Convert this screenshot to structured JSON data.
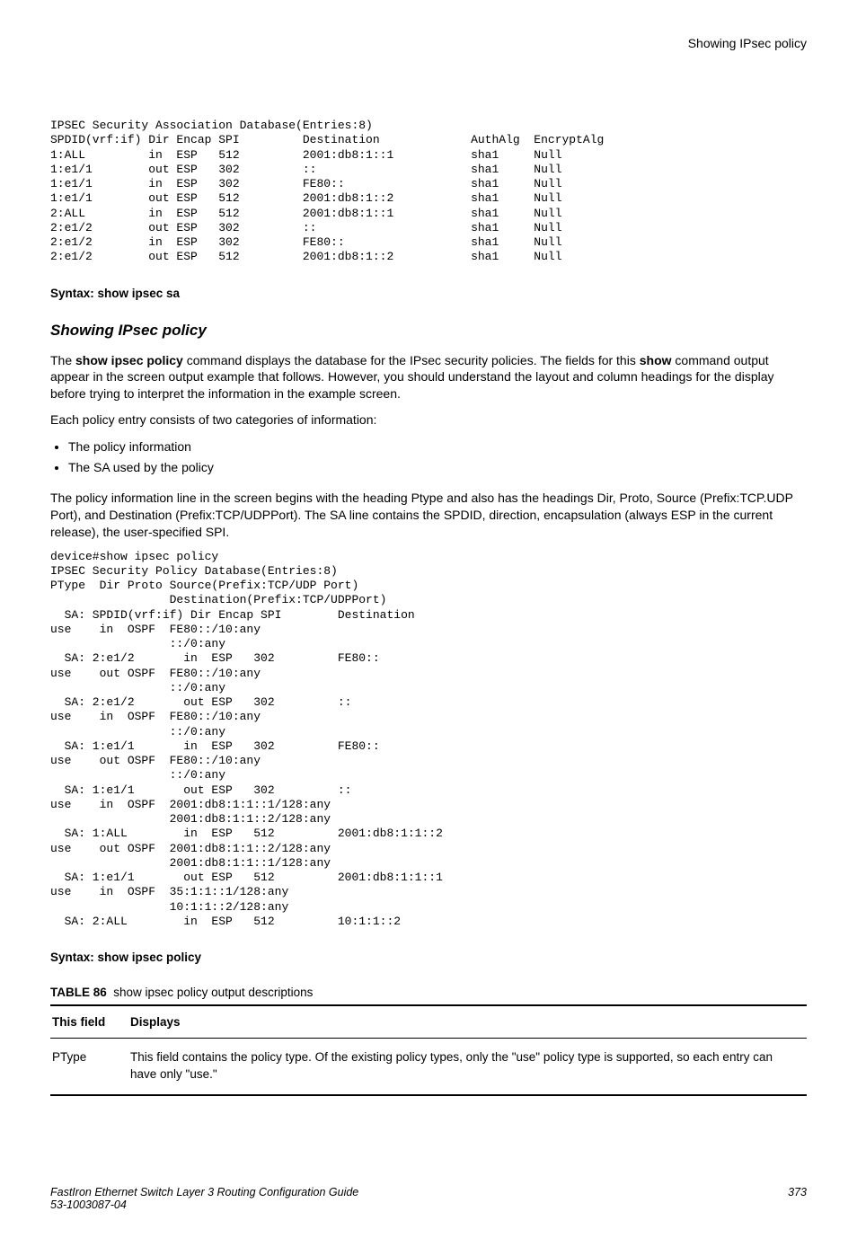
{
  "header": {
    "right_title": "Showing IPsec policy"
  },
  "code1": "IPSEC Security Association Database(Entries:8)\nSPDID(vrf:if) Dir Encap SPI         Destination             AuthAlg  EncryptAlg\n1:ALL         in  ESP   512         2001:db8:1::1           sha1     Null\n1:e1/1        out ESP   302         ::                      sha1     Null\n1:e1/1        in  ESP   302         FE80::                  sha1     Null\n1:e1/1        out ESP   512         2001:db8:1::2           sha1     Null\n2:ALL         in  ESP   512         2001:db8:1::1           sha1     Null\n2:e1/2        out ESP   302         ::                      sha1     Null\n2:e1/2        in  ESP   302         FE80::                  sha1     Null\n2:e1/2        out ESP   512         2001:db8:1::2           sha1     Null",
  "syntax1": "Syntax: show ipsec sa",
  "section_title": "Showing IPsec policy",
  "para1_pre": "The ",
  "para1_cmd1": "show ipsec policy",
  "para1_mid": " command displays the database for the IPsec security policies. The fields for this ",
  "para1_cmd2": "show",
  "para1_post": " command output appear in the screen output example that follows. However, you should understand the layout and column headings for the display before trying to interpret the information in the example screen.",
  "para2": "Each policy entry consists of two categories of information:",
  "bullets": [
    "The policy information",
    "The SA used by the policy"
  ],
  "para3": "The policy information line in the screen begins with the heading Ptype and also has the headings Dir, Proto, Source (Prefix:TCP.UDP Port), and Destination (Prefix:TCP/UDPPort). The SA line contains the SPDID, direction, encapsulation (always ESP in the current release), the user-specified SPI.",
  "code2": "device#show ipsec policy\nIPSEC Security Policy Database(Entries:8)\nPType  Dir Proto Source(Prefix:TCP/UDP Port)\n                 Destination(Prefix:TCP/UDPPort)\n  SA: SPDID(vrf:if) Dir Encap SPI        Destination\nuse    in  OSPF  FE80::/10:any\n                 ::/0:any\n  SA: 2:e1/2       in  ESP   302         FE80::\nuse    out OSPF  FE80::/10:any\n                 ::/0:any\n  SA: 2:e1/2       out ESP   302         ::\nuse    in  OSPF  FE80::/10:any\n                 ::/0:any\n  SA: 1:e1/1       in  ESP   302         FE80::\nuse    out OSPF  FE80::/10:any\n                 ::/0:any\n  SA: 1:e1/1       out ESP   302         ::\nuse    in  OSPF  2001:db8:1:1::1/128:any\n                 2001:db8:1:1::2/128:any\n  SA: 1:ALL        in  ESP   512         2001:db8:1:1::2\nuse    out OSPF  2001:db8:1:1::2/128:any\n                 2001:db8:1:1::1/128:any\n  SA: 1:e1/1       out ESP   512         2001:db8:1:1::1\nuse    in  OSPF  35:1:1::1/128:any\n                 10:1:1::2/128:any\n  SA: 2:ALL        in  ESP   512         10:1:1::2",
  "syntax2": "Syntax: show ipsec policy",
  "table": {
    "title_label": "TABLE 86",
    "title_text": "show ipsec policy output descriptions",
    "head_field": "This field",
    "head_displays": "Displays",
    "rows": [
      {
        "field": "PType",
        "desc": "This field contains the policy type. Of the existing policy types, only the \"use\" policy type is supported, so each entry can have only \"use.\""
      }
    ]
  },
  "footer": {
    "left_line1": "FastIron Ethernet Switch Layer 3 Routing Configuration Guide",
    "left_line2": "53-1003087-04",
    "right": "373"
  }
}
